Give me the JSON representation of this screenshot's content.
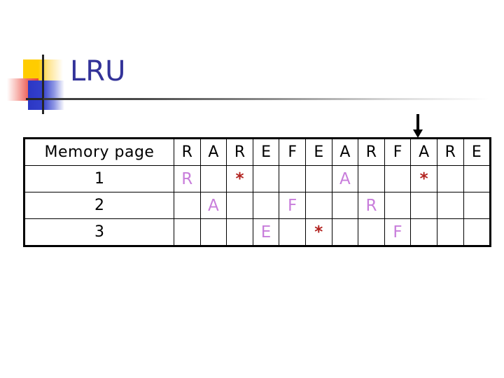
{
  "slide": {
    "title": "LRU",
    "title_color": "#333399"
  },
  "decoration": {
    "yellow_block": "yellow-gradient-square",
    "red_block": "red-gradient-square",
    "blue_block": "blue-gradient-square",
    "vertical_line": "vertical-rule",
    "horizontal_line": "horizontal-rule",
    "title_rule": "title-underline-gradient"
  },
  "pointer": {
    "icon": "down-arrow-icon",
    "points_to_column_index": 9,
    "points_to_column_label": "A"
  },
  "table": {
    "row_header_label": "Memory page",
    "sequence": [
      "R",
      "A",
      "R",
      "E",
      "F",
      "E",
      "A",
      "R",
      "F",
      "A",
      "R",
      "E"
    ],
    "rows": [
      {
        "label": "1",
        "cells": [
          "R",
          "",
          "*",
          "",
          "",
          "",
          "A",
          "",
          "",
          "*",
          "",
          ""
        ]
      },
      {
        "label": "2",
        "cells": [
          "",
          "A",
          "",
          "",
          "F",
          "",
          "",
          "R",
          "",
          "",
          "",
          ""
        ]
      },
      {
        "label": "3",
        "cells": [
          "",
          "",
          "",
          "E",
          "",
          "*",
          "",
          "",
          "F",
          "",
          "",
          ""
        ]
      }
    ],
    "colors": {
      "letter": "#C87DDB",
      "star": "#B2221F",
      "header_text": "#000000",
      "border": "#000000"
    }
  }
}
